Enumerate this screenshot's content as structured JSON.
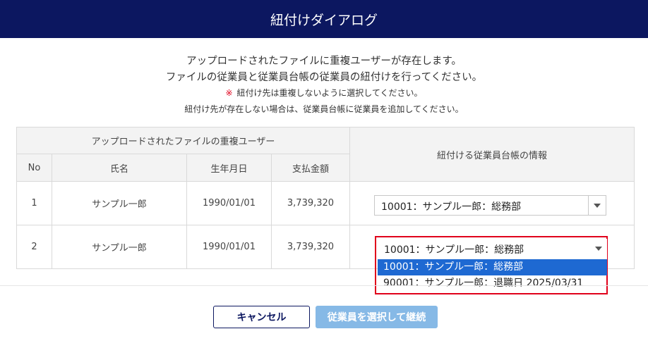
{
  "dialog": {
    "title": "紐付けダイアログ"
  },
  "messages": {
    "line1": "アップロードされたファイルに重複ユーザーが存在します。",
    "line2": "ファイルの従業員と従業員台帳の従業員の紐付けを行ってください。",
    "note_mark": "※",
    "note": "紐付け先は重複しないように選択してください。",
    "line4": "紐付け先が存在しない場合は、従業員台帳に従業員を追加してください。"
  },
  "table": {
    "group_header": "アップロードされたファイルの重複ユーザー",
    "right_header": "紐付ける従業員台帳の情報",
    "columns": {
      "no": "No",
      "name": "氏名",
      "dob": "生年月日",
      "amount": "支払金額"
    },
    "rows": [
      {
        "no": "1",
        "name": "サンプル一郎",
        "dob": "1990/01/01",
        "amount": "3,739,320",
        "selected": "10001：サンプル一郎：総務部"
      },
      {
        "no": "2",
        "name": "サンプル一郎",
        "dob": "1990/01/01",
        "amount": "3,739,320",
        "selected": "10001：サンプル一郎：総務部"
      }
    ]
  },
  "dropdown": {
    "options": [
      "10001：サンプル一郎：総務部",
      "90001：サンプル一郎：退職日 2025/03/31"
    ],
    "highlight_color": "#1e69d2",
    "outline_color": "#e0001b"
  },
  "buttons": {
    "cancel": "キャンセル",
    "continue": "従業員を選択して継続"
  },
  "colors": {
    "header_bg": "#0c1760",
    "continue_bg": "#86b9e6"
  },
  "icons": {
    "dropdown": "chevron-down-icon"
  }
}
